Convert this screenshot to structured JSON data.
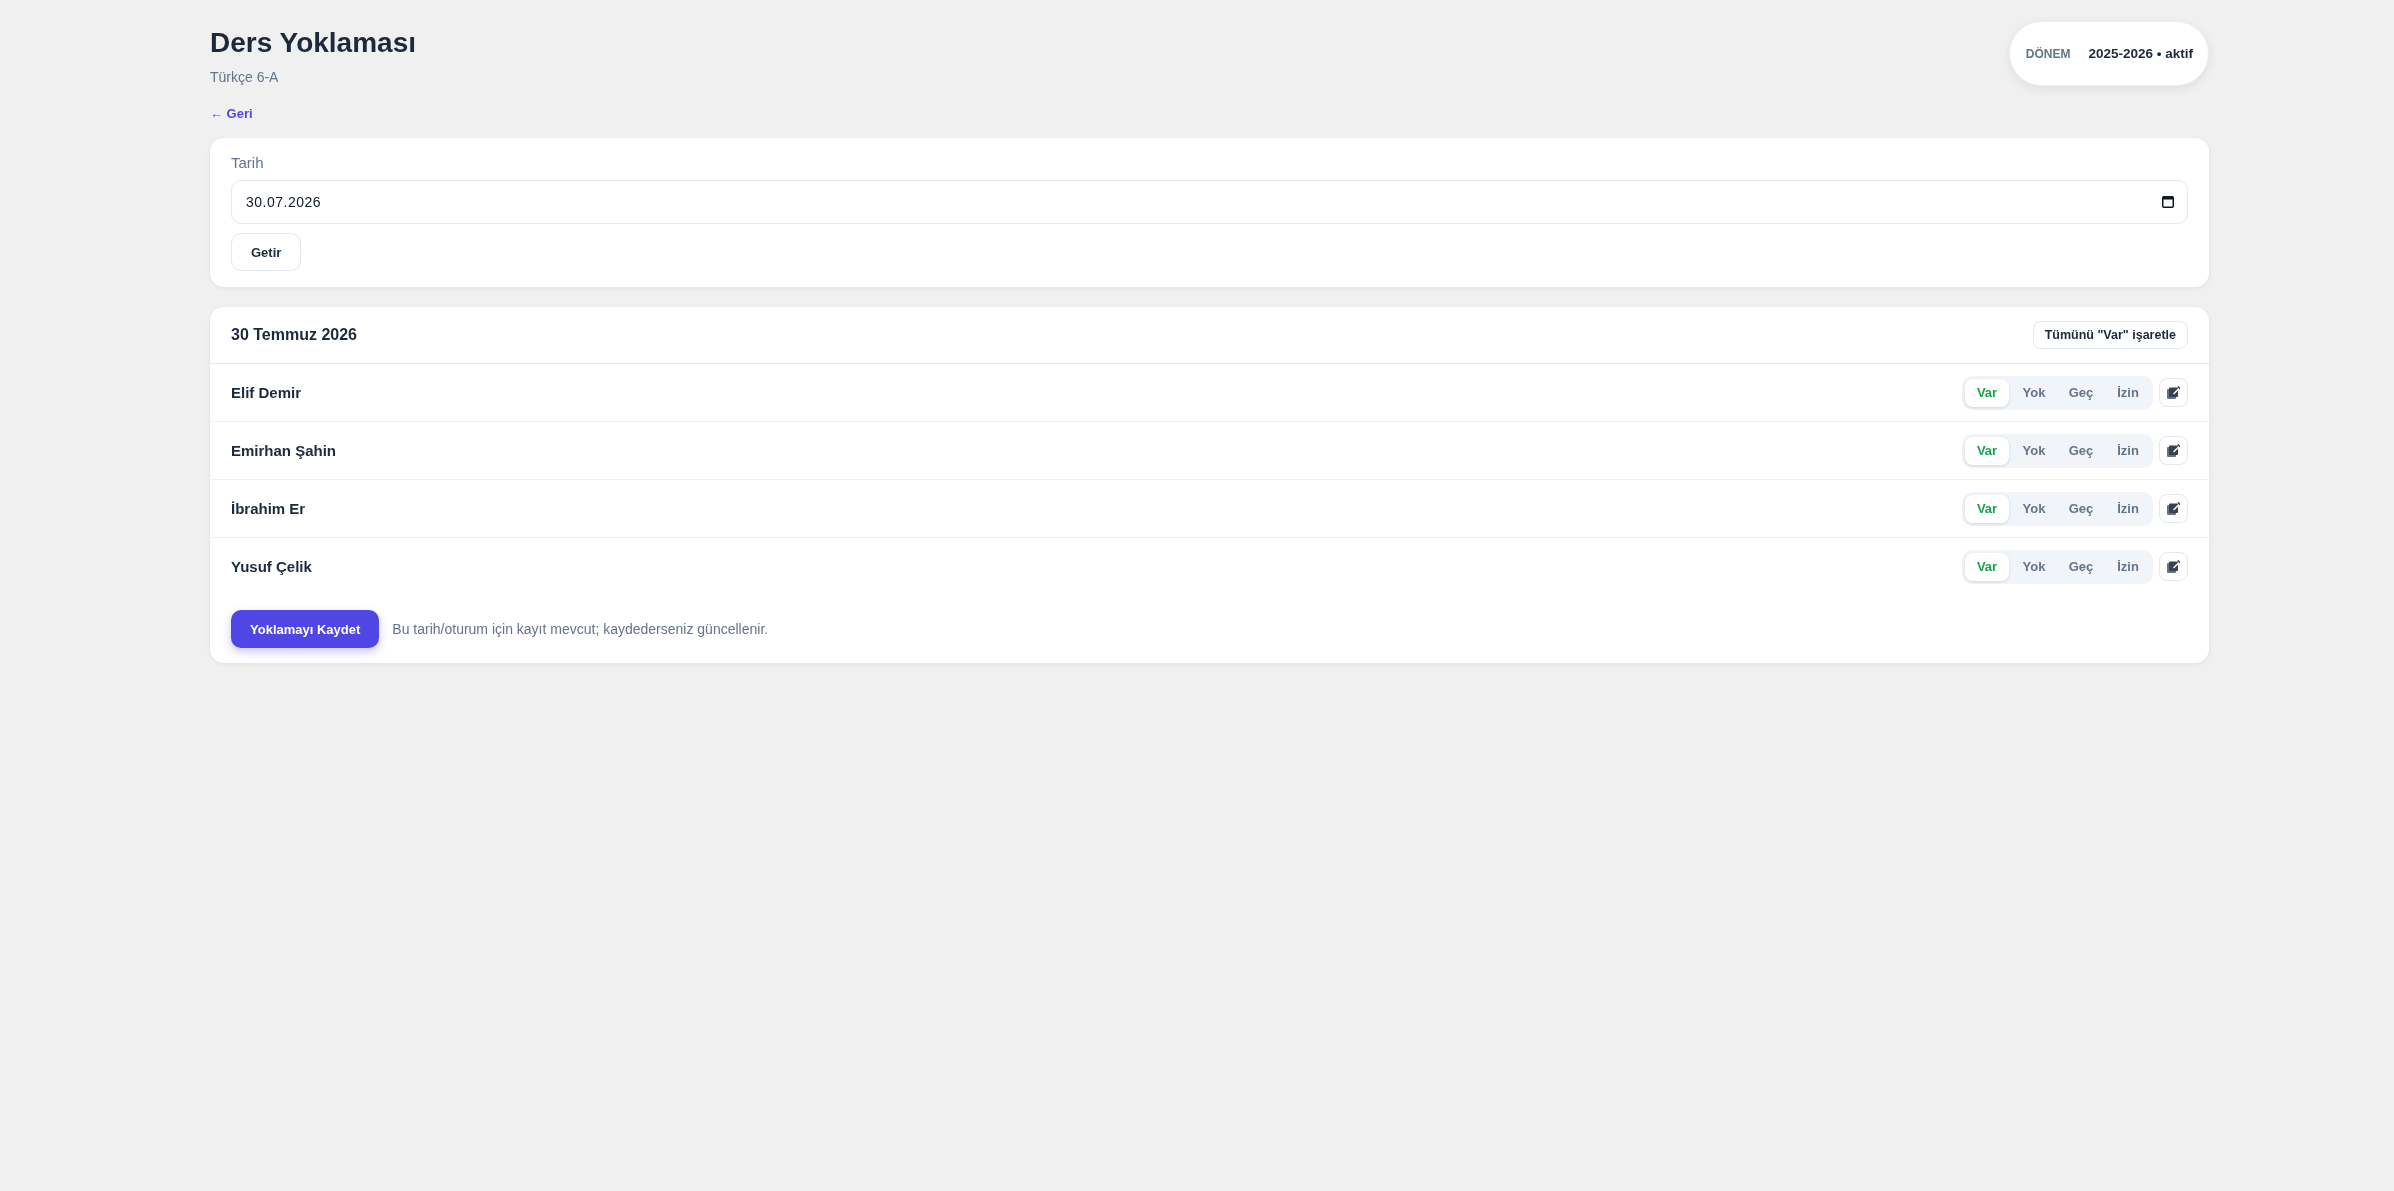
{
  "page": {
    "title": "Ders Yoklaması",
    "subtitle": "Türkçe 6-A",
    "back_link": "← Geri"
  },
  "term_badge": {
    "label": "DÖNEM",
    "value": "2025-2026 • aktif"
  },
  "date_form": {
    "label": "Tarih",
    "value": "30.07.2026",
    "button": "Getir"
  },
  "attendance": {
    "title": "30 Temmuz 2026",
    "mark_all_button": "Tümünü \"Var\" işaretle",
    "students": [
      {
        "name": "Elif Demir",
        "options": [
          {
            "label": "Var",
            "selected": true
          },
          {
            "label": "Yok",
            "selected": false
          },
          {
            "label": "Geç",
            "selected": false
          },
          {
            "label": "İzin",
            "selected": false
          }
        ]
      },
      {
        "name": "Emirhan Şahin",
        "options": [
          {
            "label": "Var",
            "selected": true
          },
          {
            "label": "Yok",
            "selected": false
          },
          {
            "label": "Geç",
            "selected": false
          },
          {
            "label": "İzin",
            "selected": false
          }
        ]
      },
      {
        "name": "İbrahim Er",
        "options": [
          {
            "label": "Var",
            "selected": true
          },
          {
            "label": "Yok",
            "selected": false
          },
          {
            "label": "Geç",
            "selected": false
          },
          {
            "label": "İzin",
            "selected": false
          }
        ]
      },
      {
        "name": "Yusuf Çelik",
        "options": [
          {
            "label": "Var",
            "selected": true
          },
          {
            "label": "Yok",
            "selected": false
          },
          {
            "label": "Geç",
            "selected": false
          },
          {
            "label": "İzin",
            "selected": false
          }
        ]
      }
    ],
    "save_button": "Yoklamayı Kaydet",
    "note": "Bu tarih/oturum için kayıt mevcut; kaydederseniz güncellenir."
  }
}
